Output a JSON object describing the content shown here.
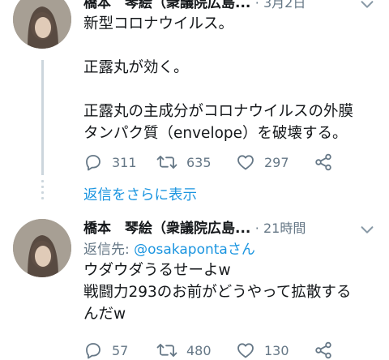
{
  "tweets": [
    {
      "display_name": "橋本　琴絵（衆議院広島...",
      "date": "· 3月2日",
      "text_lines": [
        "新型コロナウイルス。",
        "",
        "正露丸が効く。",
        "",
        "正露丸の主成分がコロナウイルスの外膜",
        "タンパク質（envelope）を破壊する。"
      ],
      "replies": "311",
      "retweets": "635",
      "likes": "297"
    },
    {
      "display_name": "橋本　琴絵（衆議院広島...",
      "date": "· 21時間",
      "reply_to_label": "返信先:",
      "reply_to_handle": "@osakapontaさん",
      "text_lines": [
        "ウダウダうるせーよw",
        "戦闘力293のお前がどうやって拡散する",
        "んだw"
      ],
      "replies": "57",
      "retweets": "480",
      "likes": "130"
    }
  ],
  "show_replies_label": "返信をさらに表示",
  "icons": {
    "reply": "speech-bubble-icon",
    "retweet": "retweet-arrows-icon",
    "like": "heart-outline-icon",
    "share": "share-nodes-icon",
    "menu": "chevron-down-icon"
  },
  "colors": {
    "link": "#1b95e0",
    "secondary_text": "#657786",
    "thread_line": "#ccd6dd"
  }
}
